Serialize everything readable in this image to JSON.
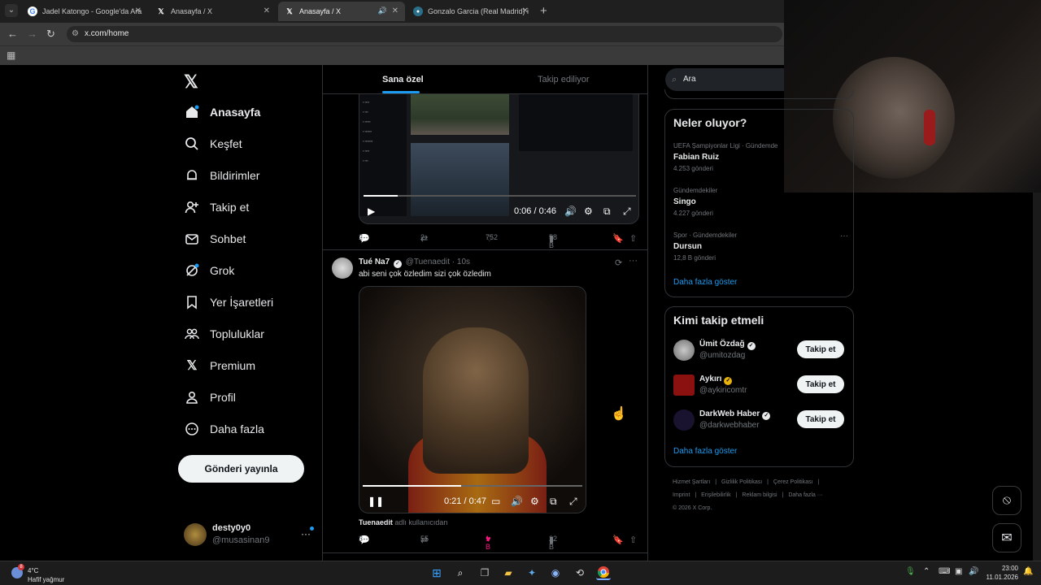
{
  "browser": {
    "tabs": [
      {
        "title": "Jadel Katongo - Google'da Ara",
        "icon": "google-icon"
      },
      {
        "title": "Anasayfa / X",
        "icon": "x-icon"
      },
      {
        "title": "Anasayfa / X",
        "icon": "x-icon",
        "active": true
      },
      {
        "title": "Gonzalo Garcia (Real Madrid) i",
        "icon": "site-icon"
      }
    ],
    "url": "x.com/home"
  },
  "sidebar": {
    "items": [
      {
        "label": "Anasayfa",
        "icon": "home-icon"
      },
      {
        "label": "Keşfet",
        "icon": "search-icon"
      },
      {
        "label": "Bildirimler",
        "icon": "bell-icon"
      },
      {
        "label": "Takip et",
        "icon": "add-person-icon"
      },
      {
        "label": "Sohbet",
        "icon": "mail-icon"
      },
      {
        "label": "Grok",
        "icon": "grok-icon"
      },
      {
        "label": "Yer İşaretleri",
        "icon": "bookmark-icon"
      },
      {
        "label": "Topluluklar",
        "icon": "communities-icon"
      },
      {
        "label": "Premium",
        "icon": "x-icon"
      },
      {
        "label": "Profil",
        "icon": "person-icon"
      },
      {
        "label": "Daha fazla",
        "icon": "more-circle-icon"
      }
    ],
    "post_button": "Gönderi yayınla",
    "account": {
      "name": "desty0y0",
      "handle": "@musasinan9"
    }
  },
  "feed": {
    "tabs": [
      "Sana özel",
      "Takip ediliyor"
    ],
    "post1": {
      "video_time": "0:06 / 0:46",
      "replies": "2",
      "reposts": "2",
      "likes": "752",
      "views": "58 B"
    },
    "post2": {
      "name": "Tué Na7",
      "handle": "@Tuenaedit",
      "time": "10s",
      "text": "abi seni çok özledim sizi çok özledim",
      "video_time": "0:21 / 0:47",
      "used_by_user": "Tuenaedit",
      "used_by_text": "adlı kullanıcıdan",
      "replies": "3",
      "reposts": "55",
      "likes": "1 B",
      "views": "22 B"
    }
  },
  "right": {
    "search_placeholder": "Ara",
    "trends_title": "Neler oluyor?",
    "trends": [
      {
        "context": "UEFA Şampiyonlar Ligi · Gündemde",
        "name": "Fabian Ruiz",
        "posts": "4.253 gönderi"
      },
      {
        "context": "Gündemdekiler",
        "name": "Singo",
        "posts": "4.227 gönderi"
      },
      {
        "context": "Spor · Gündemdekiler",
        "name": "Dursun",
        "posts": "12,8 B gönderi"
      }
    ],
    "show_more": "Daha fazla göster",
    "follow_title": "Kimi takip etmeli",
    "who_to_follow": [
      {
        "name": "Ümit Özdağ",
        "handle": "@umitozdag",
        "button": "Takip et"
      },
      {
        "name": "Aykırı",
        "handle": "@aykiricomtr",
        "button": "Takip et"
      },
      {
        "name": "DarkWeb Haber",
        "handle": "@darkwebhaber",
        "button": "Takip et"
      }
    ],
    "footer": [
      "Hizmet Şartları",
      "Gizlilik Politikası",
      "Çerez Politikası",
      "Imprint",
      "Erişilebilirlik",
      "Reklam bilgisi",
      "Daha fazla ···",
      "© 2026 X Corp."
    ]
  },
  "taskbar": {
    "weather_temp": "4°C",
    "weather_desc": "Hafif yağmur",
    "weather_badge": "8",
    "time": "23:00",
    "date": "11.01.2026"
  },
  "colors": {
    "accent": "#1d9bf0",
    "background": "#000000",
    "like": "#f91880"
  }
}
